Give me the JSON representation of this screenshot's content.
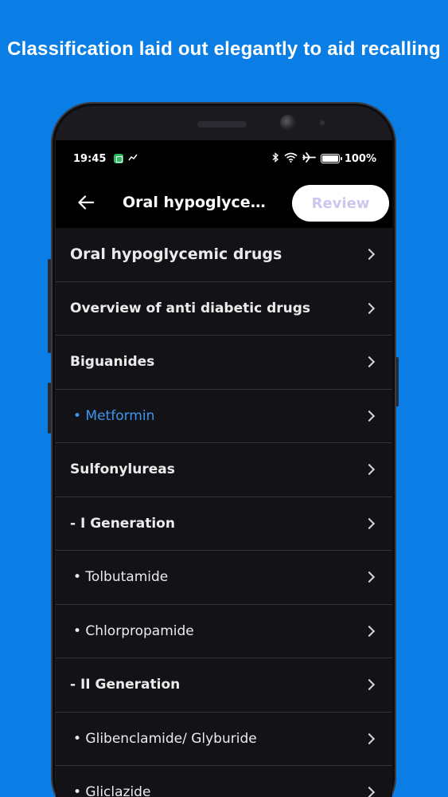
{
  "promo": {
    "headline": "Classification laid out elegantly to aid recalling"
  },
  "status_bar": {
    "time": "19:45",
    "battery_percent": "100%",
    "battery_level": 1.0,
    "icons": [
      "app-notification-icon",
      "trend-icon",
      "bluetooth-icon",
      "wifi-icon",
      "airplane-icon",
      "battery-icon"
    ]
  },
  "app_bar": {
    "title": "Oral hypoglycemi...",
    "review_label": "Review"
  },
  "colors": {
    "background": "#0a7ee4",
    "screen": "#131217",
    "accent_active": "#3a96ee",
    "review_text": "#cfc6f0"
  },
  "list": {
    "items": [
      {
        "label": "Oral hypoglycemic drugs",
        "style": "top"
      },
      {
        "label": "Overview of anti diabetic drugs",
        "style": "heading"
      },
      {
        "label": "Biguanides",
        "style": "heading"
      },
      {
        "label": "• Metformin",
        "style": "active"
      },
      {
        "label": "Sulfonylureas",
        "style": "heading"
      },
      {
        "label": "- I Generation",
        "style": "heading"
      },
      {
        "label": "• Tolbutamide",
        "style": "sub"
      },
      {
        "label": "• Chlorpropamide",
        "style": "sub"
      },
      {
        "label": "- II Generation",
        "style": "heading"
      },
      {
        "label": "• Glibenclamide/ Glyburide",
        "style": "sub"
      },
      {
        "label": "• Gliclazide",
        "style": "sub"
      }
    ]
  }
}
